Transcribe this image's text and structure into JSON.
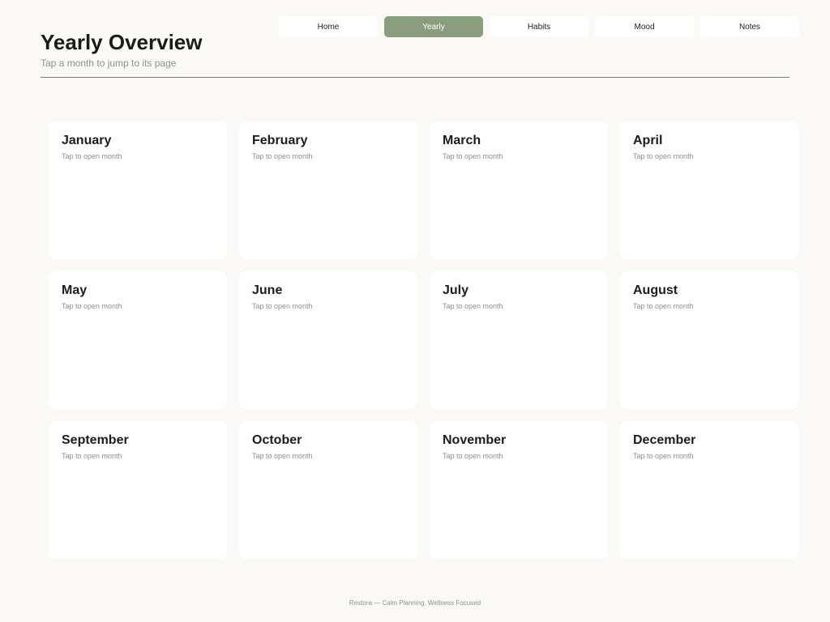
{
  "nav": {
    "tabs": [
      {
        "label": "Home",
        "active": false
      },
      {
        "label": "Yearly",
        "active": true
      },
      {
        "label": "Habits",
        "active": false
      },
      {
        "label": "Mood",
        "active": false
      },
      {
        "label": "Notes",
        "active": false
      }
    ]
  },
  "header": {
    "title": "Yearly Overview",
    "subtitle": "Tap a month to jump to its page"
  },
  "months": [
    {
      "name": "January",
      "hint": "Tap to open month"
    },
    {
      "name": "February",
      "hint": "Tap to open month"
    },
    {
      "name": "March",
      "hint": "Tap to open month"
    },
    {
      "name": "April",
      "hint": "Tap to open month"
    },
    {
      "name": "May",
      "hint": "Tap to open month"
    },
    {
      "name": "June",
      "hint": "Tap to open month"
    },
    {
      "name": "July",
      "hint": "Tap to open month"
    },
    {
      "name": "August",
      "hint": "Tap to open month"
    },
    {
      "name": "September",
      "hint": "Tap to open month"
    },
    {
      "name": "October",
      "hint": "Tap to open month"
    },
    {
      "name": "November",
      "hint": "Tap to open month"
    },
    {
      "name": "December",
      "hint": "Tap to open month"
    }
  ],
  "footer": {
    "text": "Restora  —  Calm Planning, Wellness Focused"
  },
  "colors": {
    "background": "#faf9f5",
    "accent": "#8a9e7f",
    "card": "#ffffff"
  }
}
